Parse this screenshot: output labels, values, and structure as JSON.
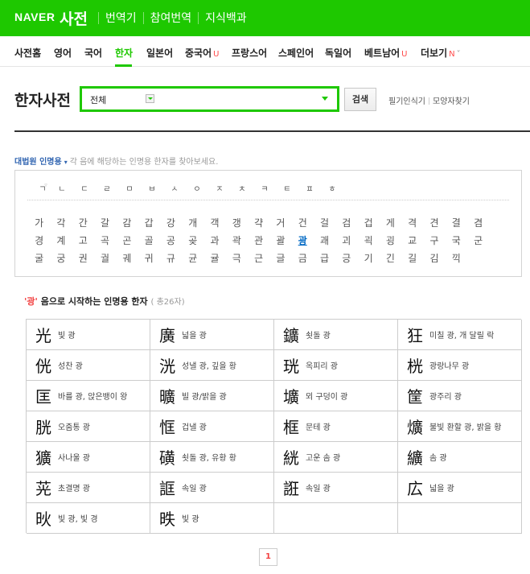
{
  "header": {
    "logo": "NAVER",
    "brand": "사전",
    "nav": [
      "번역기",
      "참여번역",
      "지식백과"
    ]
  },
  "subnav": [
    {
      "label": "사전홈",
      "flag": ""
    },
    {
      "label": "영어",
      "flag": ""
    },
    {
      "label": "국어",
      "flag": ""
    },
    {
      "label": "한자",
      "flag": "",
      "active": true
    },
    {
      "label": "일본어",
      "flag": ""
    },
    {
      "label": "중국어",
      "flag": "U"
    },
    {
      "label": "프랑스어",
      "flag": ""
    },
    {
      "label": "스페인어",
      "flag": ""
    },
    {
      "label": "독일어",
      "flag": ""
    },
    {
      "label": "베트남어",
      "flag": "U"
    },
    {
      "label": "더보기",
      "flag": "N"
    }
  ],
  "search": {
    "title": "한자사전",
    "select_value": "전체",
    "button": "검색",
    "tools": [
      "필기인식기",
      "모양자찾기"
    ]
  },
  "info": {
    "tag": "대법원 인명용",
    "caret": "▾",
    "desc": "각 음에 해당하는 인명용 한자를 찾아보세요."
  },
  "index": {
    "consonants": [
      "ㄱ",
      "ㄴ",
      "ㄷ",
      "ㄹ",
      "ㅁ",
      "ㅂ",
      "ㅅ",
      "ㅇ",
      "ㅈ",
      "ㅊ",
      "ㅋ",
      "ㅌ",
      "ㅍ",
      "ㅎ"
    ],
    "rows": [
      [
        "가",
        "각",
        "간",
        "갈",
        "감",
        "갑",
        "강",
        "개",
        "객",
        "갱",
        "갹",
        "거",
        "건",
        "걸",
        "검",
        "겁",
        "게",
        "격",
        "견",
        "결",
        "겸"
      ],
      [
        "경",
        "계",
        "고",
        "곡",
        "곤",
        "골",
        "공",
        "곶",
        "과",
        "곽",
        "관",
        "괄",
        "광",
        "괘",
        "괴",
        "괵",
        "굉",
        "교",
        "구",
        "국",
        "군"
      ],
      [
        "굴",
        "궁",
        "권",
        "궐",
        "궤",
        "귀",
        "규",
        "균",
        "귤",
        "극",
        "근",
        "글",
        "금",
        "급",
        "긍",
        "기",
        "긴",
        "길",
        "김",
        "끽"
      ]
    ],
    "selected": "광"
  },
  "result": {
    "q_open": "'",
    "query": "광",
    "q_close": "'",
    "text": "음으로 시작하는 인명용 한자",
    "count": "( 총26자)"
  },
  "entries": [
    {
      "hanja": "光",
      "meaning": "빛 광"
    },
    {
      "hanja": "廣",
      "meaning": "넓을 광"
    },
    {
      "hanja": "鑛",
      "meaning": "쇳돌 광"
    },
    {
      "hanja": "狂",
      "meaning": "미칠 광, 개 달릴 락"
    },
    {
      "hanja": "侊",
      "meaning": "성찬 광"
    },
    {
      "hanja": "洸",
      "meaning": "성낼 광, 깊을 황"
    },
    {
      "hanja": "珖",
      "meaning": "옥피리 광"
    },
    {
      "hanja": "桄",
      "meaning": "광랑나무 광"
    },
    {
      "hanja": "匡",
      "meaning": "바를 광, 앉은뱅이 왕"
    },
    {
      "hanja": "曠",
      "meaning": "빌 광/밝을 광"
    },
    {
      "hanja": "壙",
      "meaning": "뫼 구덩이 광"
    },
    {
      "hanja": "筐",
      "meaning": "광주리 광"
    },
    {
      "hanja": "胱",
      "meaning": "오줌통 광"
    },
    {
      "hanja": "恇",
      "meaning": "겁낼 광"
    },
    {
      "hanja": "框",
      "meaning": "문테 광"
    },
    {
      "hanja": "爌",
      "meaning": "불빛 환할 광, 밝을 황"
    },
    {
      "hanja": "獷",
      "meaning": "사나울 광"
    },
    {
      "hanja": "磺",
      "meaning": "쇳돌 광, 유황 황"
    },
    {
      "hanja": "絖",
      "meaning": "고운 솜 광"
    },
    {
      "hanja": "纊",
      "meaning": "솜 광"
    },
    {
      "hanja": "茪",
      "meaning": "초결명 광"
    },
    {
      "hanja": "誆",
      "meaning": "속일 광"
    },
    {
      "hanja": "誑",
      "meaning": "속일 광"
    },
    {
      "hanja": "広",
      "meaning": "넓을 광"
    },
    {
      "hanja": "炚",
      "meaning": "빛 광, 빛 경"
    },
    {
      "hanja": "昳",
      "meaning": "빛 광"
    }
  ],
  "pagination": {
    "current": "1"
  }
}
